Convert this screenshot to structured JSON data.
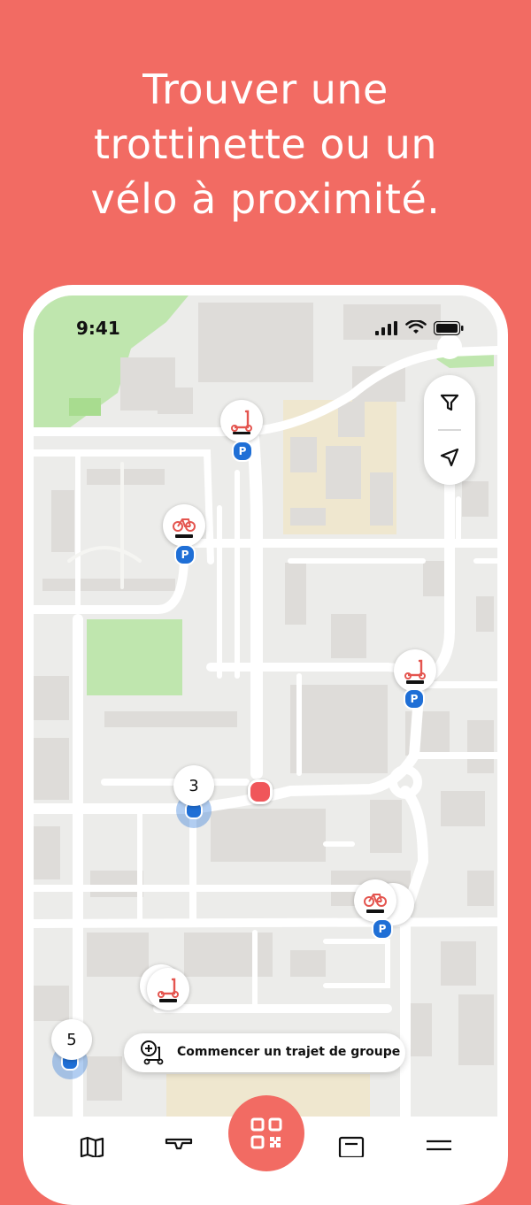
{
  "headline": {
    "line1": "Trouver une",
    "line2": "trottinette ou un",
    "line3": "vélo à proximité."
  },
  "status_bar": {
    "time": "9:41",
    "icons": [
      "cellular-signal-icon",
      "wifi-icon",
      "battery-icon"
    ]
  },
  "map_tools": {
    "filter_icon": "filter-icon",
    "locate_icon": "navigation-arrow-icon"
  },
  "markers": {
    "parking_letter": "P",
    "cluster_center": "3",
    "cluster_left": "5"
  },
  "group_ride": {
    "label": "Commencer un trajet de groupe",
    "icon": "group-scooter-add-icon"
  },
  "tab_bar": {
    "icons": [
      "map-icon",
      "inbox-icon",
      "qr-code-scan-icon",
      "document-icon",
      "menu-icon"
    ]
  },
  "colors": {
    "brand": "#f26b63",
    "parking_blue": "#1f6fd6",
    "park_green": "#b9e3a6",
    "map_background": "#ececea",
    "road": "#ffffff"
  }
}
